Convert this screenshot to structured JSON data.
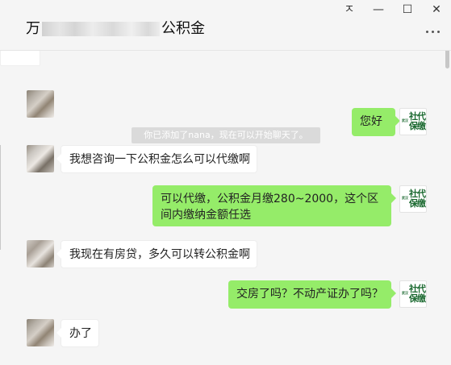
{
  "window": {
    "controls": {
      "pin": "ㅈ",
      "minimize": "—",
      "maximize": "☐",
      "close": "✕"
    },
    "title_prefix": "万",
    "title_suffix": "公积金"
  },
  "chat": {
    "system_notice": "你已添加了nana，现在可以开始聊天了。",
    "messages": [
      {
        "side": "right",
        "text": "您好"
      },
      {
        "side": "left",
        "text": "我想咨询一下公积金怎么可以代缴啊"
      },
      {
        "side": "right",
        "text": "可以代缴，公积金月缴280~2000，这个区间内缴纳金额任选"
      },
      {
        "side": "left",
        "text": "我现在有房贷，多久可以转公积金啊"
      },
      {
        "side": "right",
        "text": "交房了吗？不动产证办了吗？"
      },
      {
        "side": "left",
        "text": "办了"
      }
    ]
  },
  "brand": {
    "small_text": "武汉",
    "line1": "社代",
    "line2": "保缴"
  },
  "colors": {
    "background": "#f5f5f5",
    "right_bubble": "#95ec69",
    "left_bubble": "#ffffff",
    "brand_green": "#1c6a31",
    "notice_bg": "#dadada"
  }
}
